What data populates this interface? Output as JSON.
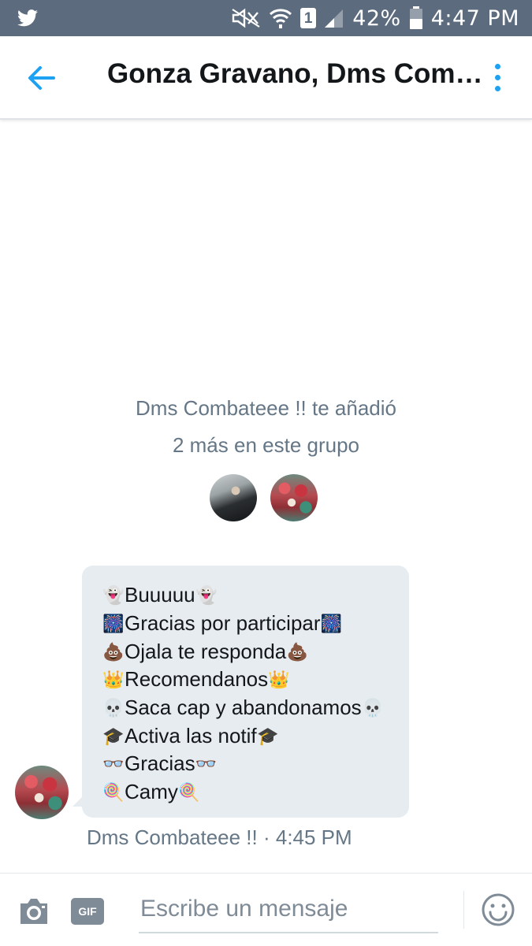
{
  "status_bar": {
    "battery": "42%",
    "time": "4:47 PM",
    "sim_label": "1",
    "icons": [
      "twitter-bird-icon",
      "mute-icon",
      "wifi-icon",
      "sim-icon",
      "signal-icon",
      "battery-icon"
    ]
  },
  "header": {
    "title": "Gonza Gravano, Dms Comba…",
    "icons": [
      "back-arrow-icon",
      "more-vertical-icon"
    ],
    "accent_color": "#1da1f2"
  },
  "system_message": {
    "line1": "Dms Combateee !! te añadió",
    "line2": "2 más en este grupo",
    "avatars": [
      "added-user-avatar-1",
      "added-user-avatar-2"
    ]
  },
  "message": {
    "lines": [
      {
        "emoji": "👻",
        "text": "Buuuuu"
      },
      {
        "emoji": "🎆",
        "text": "Gracias por participar"
      },
      {
        "emoji": "💩",
        "text": "Ojala te responda"
      },
      {
        "emoji": "👑",
        "text": "Recomendanos"
      },
      {
        "emoji": "💀",
        "text": "Saca cap y abandonamos"
      },
      {
        "emoji": "🎓",
        "text": "Activa las notif"
      },
      {
        "emoji": "👓",
        "text": "Gracias"
      },
      {
        "emoji": "🍭",
        "text": "Camy"
      }
    ],
    "meta": "Dms Combateee !! · 4:45 PM",
    "bubble_color": "#e6ecf0"
  },
  "composer": {
    "placeholder": "Escribe un mensaje",
    "gif_label": "GIF",
    "icons": [
      "camera-icon",
      "gif-icon",
      "emoji-icon"
    ]
  }
}
